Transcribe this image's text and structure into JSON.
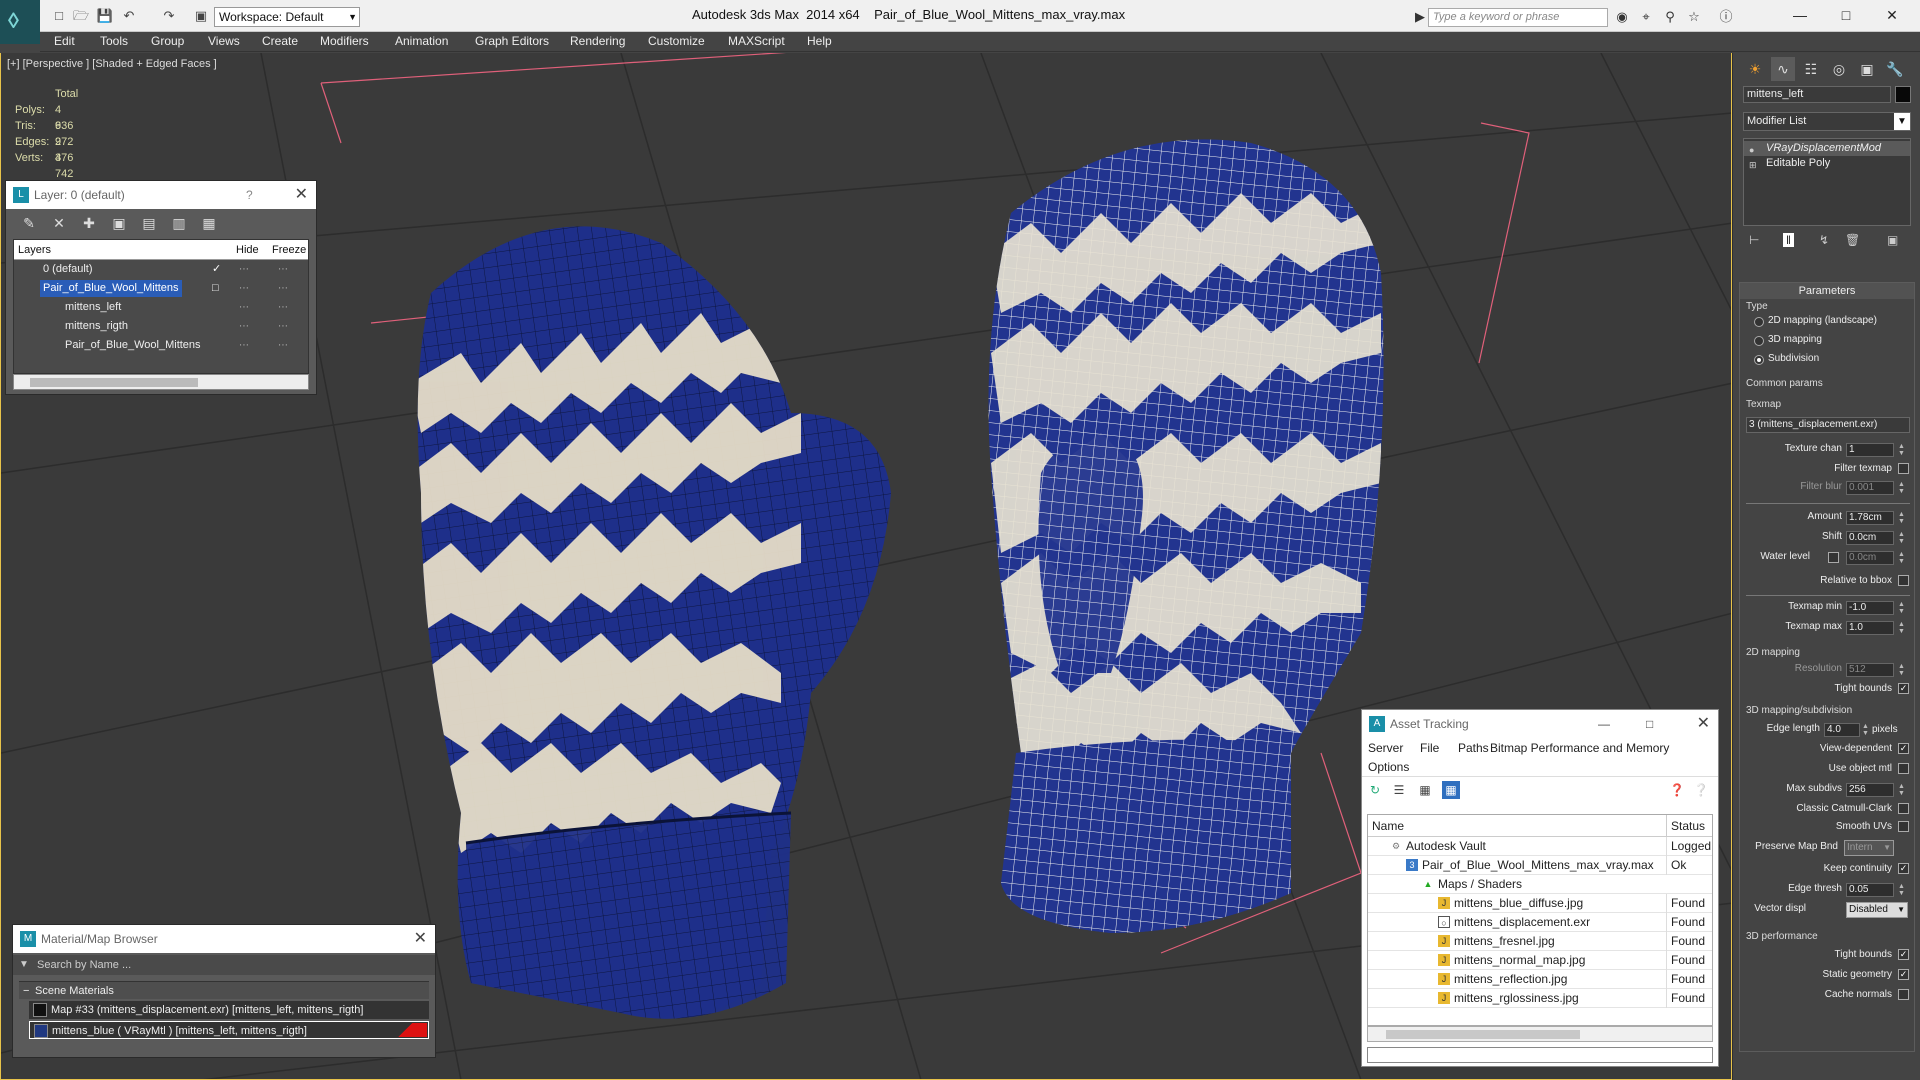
{
  "titlebar": {
    "workspace_label": "Workspace: Default",
    "app_title": "Autodesk 3ds Max  2014 x64",
    "file_title": "Pair_of_Blue_Wool_Mittens_max_vray.max",
    "search_placeholder": "Type a keyword or phrase"
  },
  "menu": [
    "Edit",
    "Tools",
    "Group",
    "Views",
    "Create",
    "Modifiers",
    "Animation",
    "Graph Editors",
    "Rendering",
    "Customize",
    "MAXScript",
    "Help"
  ],
  "viewport": {
    "label": "[+] [Perspective ] [Shaded + Edged Faces ]",
    "stats_header": "Total",
    "stats": [
      {
        "key": "Polys:",
        "value": "4 636"
      },
      {
        "key": "Tris:",
        "value": "9 272"
      },
      {
        "key": "Edges:",
        "value": "9 376"
      },
      {
        "key": "Verts:",
        "value": "4 742"
      }
    ]
  },
  "layer_panel": {
    "title": "Layer: 0 (default)",
    "help": "?",
    "columns": [
      "Layers",
      "Hide",
      "Freeze"
    ],
    "rows": [
      {
        "name": "0 (default)"
      },
      {
        "name": "Pair_of_Blue_Wool_Mittens"
      },
      {
        "name": "mittens_left"
      },
      {
        "name": "mittens_rigth"
      },
      {
        "name": "Pair_of_Blue_Wool_Mittens"
      }
    ]
  },
  "material_browser": {
    "title": "Material/Map Browser",
    "search_placeholder": "Search by Name ...",
    "group": "Scene Materials",
    "items": [
      "Map #33 (mittens_displacement.exr)  [mittens_left, mittens_rigth]",
      "mittens_blue  ( VRayMtl )  [mittens_left, mittens_rigth]"
    ]
  },
  "asset_tracking": {
    "title": "Asset Tracking",
    "menu": [
      "Server",
      "File",
      "Paths",
      "Bitmap Performance and Memory",
      "Options"
    ],
    "columns": [
      "Name",
      "Status"
    ],
    "rows": [
      {
        "name": "Autodesk Vault",
        "status": "Logged O"
      },
      {
        "name": "Pair_of_Blue_Wool_Mittens_max_vray.max",
        "status": "Ok"
      },
      {
        "name": "Maps / Shaders",
        "status": ""
      },
      {
        "name": "mittens_blue_diffuse.jpg",
        "status": "Found"
      },
      {
        "name": "mittens_displacement.exr",
        "status": "Found"
      },
      {
        "name": "mittens_fresnel.jpg",
        "status": "Found"
      },
      {
        "name": "mittens_normal_map.jpg",
        "status": "Found"
      },
      {
        "name": "mittens_reflection.jpg",
        "status": "Found"
      },
      {
        "name": "mittens_rglossiness.jpg",
        "status": "Found"
      }
    ]
  },
  "command_panel": {
    "object_name": "mittens_left",
    "modifier_list": "Modifier List",
    "stack": [
      "VRayDisplacementMod",
      "Editable Poly"
    ],
    "parameters_title": "Parameters",
    "type_group": "Type",
    "type_options": [
      "2D mapping (landscape)",
      "3D mapping",
      "Subdivision"
    ],
    "common_group": "Common params",
    "texmap_label": "Texmap",
    "texmap_value": "3 (mittens_displacement.exr)",
    "texture_chan_label": "Texture chan",
    "texture_chan_value": "1",
    "filter_texmap": "Filter texmap",
    "filter_blur_label": "Filter blur",
    "filter_blur_value": "0.001",
    "amount_label": "Amount",
    "amount_value": "1.78cm",
    "shift_label": "Shift",
    "shift_value": "0.0cm",
    "water_level_label": "Water level",
    "water_level_value": "0.0cm",
    "relative_bbox": "Relative to bbox",
    "texmap_min_label": "Texmap min",
    "texmap_min_value": "-1.0",
    "texmap_max_label": "Texmap max",
    "texmap_max_value": "1.0",
    "group_2d": "2D mapping",
    "resolution_label": "Resolution",
    "resolution_value": "512",
    "tight_bounds_label": "Tight bounds",
    "group_3d": "3D mapping/subdivision",
    "edge_length_label": "Edge length",
    "edge_length_value": "4.0",
    "pixels_label": "pixels",
    "view_dependent": "View-dependent",
    "use_object_mtl": "Use object mtl",
    "max_subdivs_label": "Max subdivs",
    "max_subdivs_value": "256",
    "classic_catmull": "Classic Catmull-Clark",
    "smooth_uvs": "Smooth UVs",
    "preserve_map_label": "Preserve Map Bnd",
    "preserve_map_value": "Intern",
    "keep_continuity": "Keep continuity",
    "edge_thresh_label": "Edge thresh",
    "edge_thresh_value": "0.05",
    "vector_displ_label": "Vector displ",
    "vector_displ_value": "Disabled",
    "group_perf": "3D performance",
    "perf_tight_bounds": "Tight bounds",
    "static_geometry": "Static geometry",
    "cache_normals": "Cache normals"
  },
  "colors": {
    "mitten_blue": "#1e2f8a",
    "mitten_cream": "#e6ddc8",
    "selection_blue": "#2a5db8",
    "viewport_bg": "#3a3a3a",
    "bbox_pink": "#e0607a"
  }
}
